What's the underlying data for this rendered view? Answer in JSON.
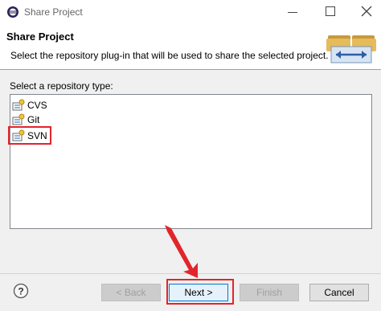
{
  "window": {
    "title": "Share Project",
    "icon": "eclipse-icon"
  },
  "header": {
    "title": "Share Project",
    "description": "Select the repository plug-in that will be used to share the selected project."
  },
  "repository_list": {
    "label": "Select a repository type:",
    "items": [
      {
        "label": "CVS",
        "icon": "repository-plugin-icon"
      },
      {
        "label": "Git",
        "icon": "repository-plugin-icon"
      },
      {
        "label": "SVN",
        "icon": "repository-plugin-icon",
        "highlighted": true
      }
    ]
  },
  "buttons": {
    "back": "< Back",
    "next": "Next >",
    "finish": "Finish",
    "cancel": "Cancel",
    "help": "?"
  },
  "colors": {
    "highlight": "#e2252b",
    "header_bg": "#ffffff",
    "dialog_bg": "#f0f0f0"
  }
}
